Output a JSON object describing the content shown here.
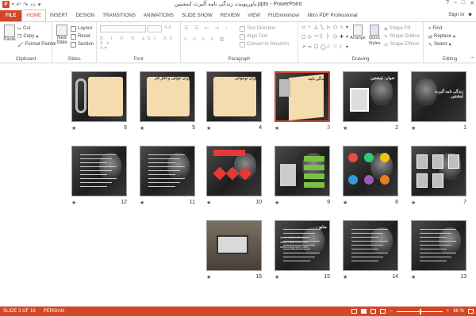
{
  "window": {
    "title": "پاورپوینت زندگی نامه آلبرت اینشتین.pptx - PowerPoint",
    "app_icon_label": "P",
    "controls": [
      "?",
      "–",
      "□",
      "✕"
    ]
  },
  "tabs": [
    "FILE",
    "HOME",
    "INSERT",
    "DESIGN",
    "TRANSITIONS",
    "ANIMATIONS",
    "SLIDE SHOW",
    "REVIEW",
    "VIEW",
    "FILEminimizer",
    "Nitro PDF Professional"
  ],
  "active_tab": "HOME",
  "sign_in": "Sign in",
  "ribbon": {
    "clipboard": {
      "label": "Clipboard",
      "paste": "Paste",
      "cut": "Cut",
      "copy": "Copy",
      "format_painter": "Format Painter"
    },
    "slides": {
      "label": "Slides",
      "new_slide": "New Slide",
      "layout": "Layout",
      "reset": "Reset",
      "section": "Section"
    },
    "font": {
      "label": "Font"
    },
    "paragraph": {
      "label": "Paragraph",
      "text_direction": "Text Direction",
      "align_text": "Align Text",
      "convert_smartart": "Convert to SmartArt"
    },
    "drawing": {
      "label": "Drawing",
      "arrange": "Arrange",
      "quick_styles": "Quick Styles",
      "shape_fill": "Shape Fill",
      "shape_outline": "Shape Outline",
      "shape_effects": "Shape Effects"
    },
    "editing": {
      "label": "Editing",
      "find": "Find",
      "replace": "Replace",
      "select": "Select"
    }
  },
  "slides": [
    {
      "number": "1",
      "title": "زندگی نامه آلبرت اینشتین",
      "style": "face-title"
    },
    {
      "number": "2",
      "title": "عنوان: اینشتین",
      "style": "photo"
    },
    {
      "number": "3",
      "title": "زندگی نامه",
      "style": "paper-photo",
      "selected": true
    },
    {
      "number": "4",
      "title": "دوران نوجوانی",
      "style": "paper"
    },
    {
      "number": "5",
      "title": "دوران جوانی و آغاز کار",
      "style": "paper"
    },
    {
      "number": "6",
      "title": "",
      "style": "paper-chain"
    },
    {
      "number": "7",
      "title": "",
      "style": "photos-collage"
    },
    {
      "number": "8",
      "title": "",
      "style": "bubbles"
    },
    {
      "number": "9",
      "title": "",
      "style": "list-green"
    },
    {
      "number": "10",
      "title": "",
      "style": "ribbons"
    },
    {
      "number": "11",
      "title": "",
      "style": "text-dark"
    },
    {
      "number": "12",
      "title": "",
      "style": "text-dark"
    },
    {
      "number": "13",
      "title": "",
      "style": "text-dark"
    },
    {
      "number": "14",
      "title": "",
      "style": "text-dark"
    },
    {
      "number": "15",
      "title": "منابع :",
      "style": "sources",
      "lines": [
        "www.wikipedia.com",
        "www.britannica.com",
        "www.biography.com"
      ]
    },
    {
      "number": "16",
      "title": "",
      "style": "laptop"
    }
  ],
  "status": {
    "slide_info": "SLIDE 3 OF 16",
    "language": "PERSIAN",
    "zoom": "66 %",
    "zoom_level": 0.66
  },
  "colors": {
    "accent": "#d24726",
    "selection": "#d24726"
  }
}
